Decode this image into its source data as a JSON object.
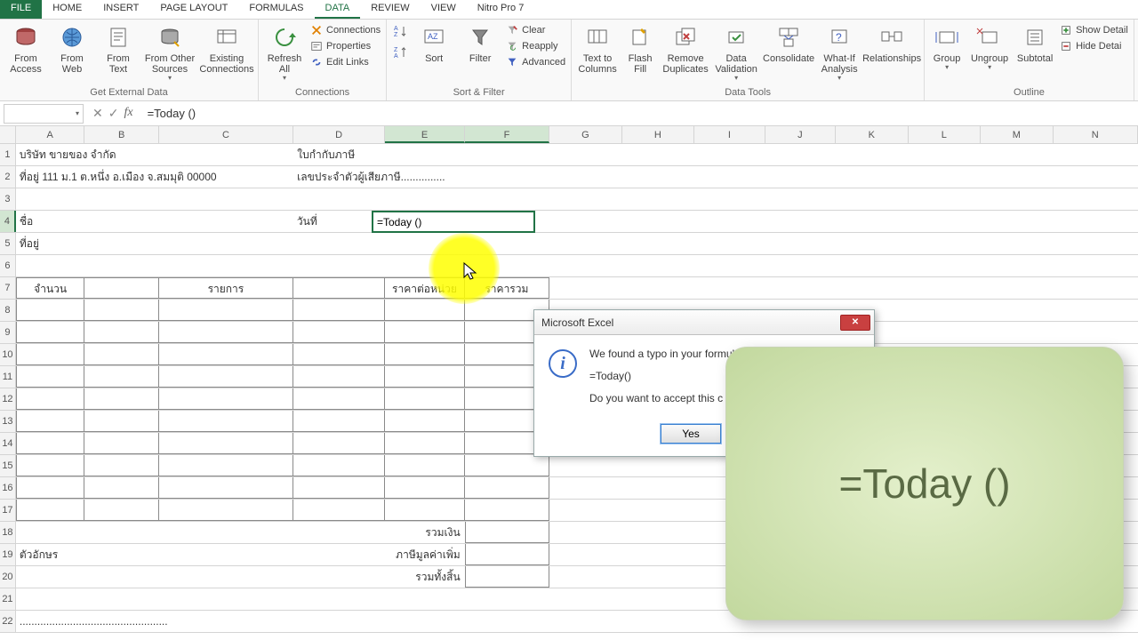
{
  "tabs": {
    "file": "FILE",
    "home": "HOME",
    "insert": "INSERT",
    "pagelayout": "PAGE LAYOUT",
    "formulas": "FORMULAS",
    "data": "DATA",
    "review": "REVIEW",
    "view": "VIEW",
    "nitro": "Nitro Pro 7"
  },
  "ribbon": {
    "get_external_data": {
      "from_access": "From Access",
      "from_web": "From Web",
      "from_text": "From Text",
      "from_other": "From Other Sources",
      "existing": "Existing Connections",
      "label": "Get External Data"
    },
    "connections": {
      "refresh": "Refresh All",
      "conn": "Connections",
      "prop": "Properties",
      "edit": "Edit Links",
      "label": "Connections"
    },
    "sort_filter": {
      "sort": "Sort",
      "filter": "Filter",
      "clear": "Clear",
      "reapply": "Reapply",
      "advanced": "Advanced",
      "label": "Sort & Filter"
    },
    "data_tools": {
      "t2c": "Text to Columns",
      "flash": "Flash Fill",
      "dup": "Remove Duplicates",
      "val": "Data Validation",
      "cons": "Consolidate",
      "what": "What-If Analysis",
      "rel": "Relationships",
      "label": "Data Tools"
    },
    "outline": {
      "group": "Group",
      "ungroup": "Ungroup",
      "subtotal": "Subtotal",
      "show": "Show Detail",
      "hide": "Hide Detai",
      "label": "Outline"
    }
  },
  "formula_bar": {
    "value": "=Today ()"
  },
  "columns": [
    "A",
    "B",
    "C",
    "D",
    "E",
    "F",
    "G",
    "H",
    "I",
    "J",
    "K",
    "L",
    "M",
    "N"
  ],
  "rows": [
    "1",
    "2",
    "3",
    "4",
    "5",
    "6",
    "7",
    "8",
    "9",
    "10",
    "11",
    "12",
    "13",
    "14",
    "15",
    "16",
    "17",
    "18",
    "19",
    "20",
    "21",
    "22"
  ],
  "cells": {
    "A1": "บริษัท ขายของ จำกัด",
    "D1": "ใบกำกับภาษี",
    "A2": "ที่อยู่ 111 ม.1 ต.หนึ่ง อ.เมือง จ.สมมุติ 00000",
    "D2": "เลขประจำตัวผู้เสียภาษี...............",
    "A4": "ชื่อ",
    "D4": "วันที่",
    "E4": "=Today ()",
    "A5": "ที่อยู่",
    "A7": "จำนวน",
    "C7": "รายการ",
    "E7": "ราคาต่อหน่วย",
    "F7": "ราคารวม",
    "E18": "รวมเงิน",
    "A19": "ตัวอักษร",
    "E19": "ภาษีมูลค่าเพิ่ม",
    "E20": "รวมทั้งสิ้น",
    "A22": ".................................................."
  },
  "dialog": {
    "title": "Microsoft Excel",
    "line1": "We found a typo in your formul",
    "line2": "=Today()",
    "line3": "Do you want to accept this c",
    "yes": "Yes"
  },
  "overlay": "=Today ()"
}
